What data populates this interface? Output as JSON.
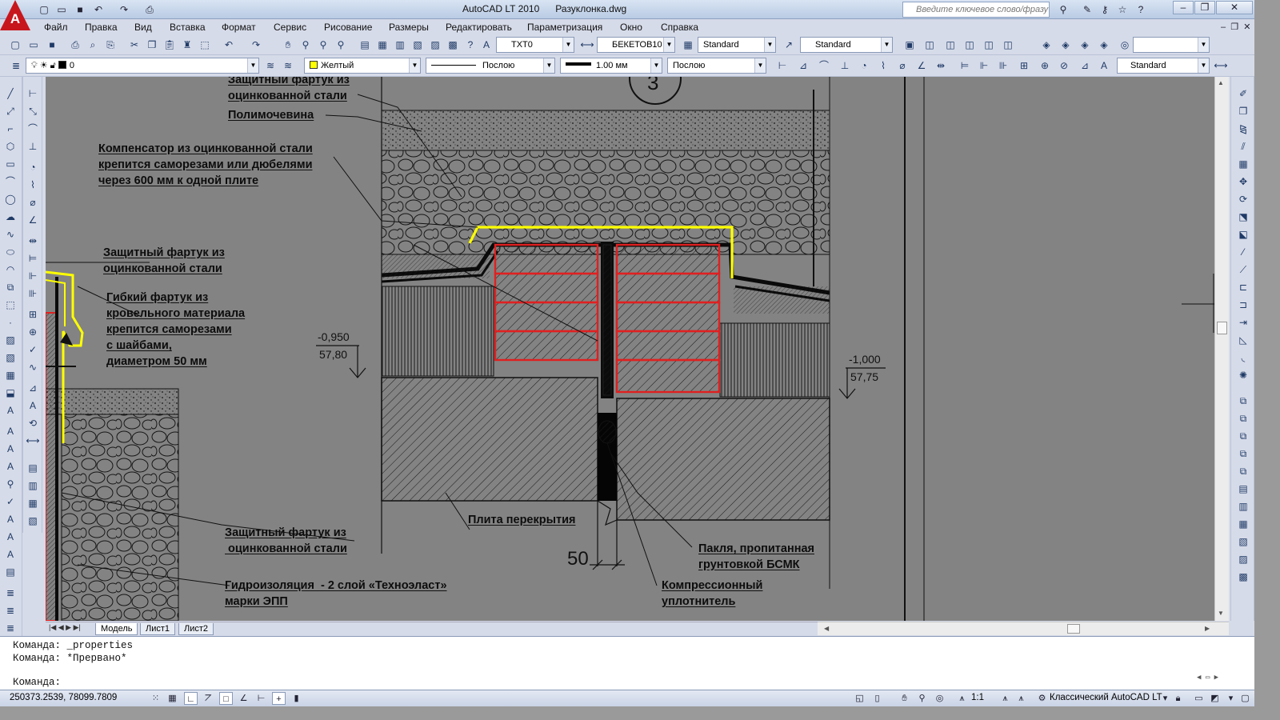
{
  "title_bar": {
    "app_title": "AutoCAD LT 2010",
    "file_name": "Разуклонка.dwg",
    "search_placeholder": "Введите ключевое слово/фразу",
    "logo_letter": "A"
  },
  "menu": [
    "Файл",
    "Правка",
    "Вид",
    "Вставка",
    "Формат",
    "Сервис",
    "Рисование",
    "Размеры",
    "Редактировать",
    "Параметризация",
    "Окно",
    "Справка"
  ],
  "toolbar_standard": {
    "text_style": "TXT0",
    "dim_style": "БЕКЕТОВ10",
    "table_style": "Standard",
    "multileader_style": "Standard",
    "empty_combo": ""
  },
  "toolbar_layers": {
    "layer": "0",
    "color": "Желтый",
    "color_hex": "#ffff00",
    "linetype": "Послою",
    "lineweight": "1.00 мм",
    "plot_style": "Послою",
    "dim_style_2": "Standard"
  },
  "drawing": {
    "annotations": [
      "Защитный фартук из\nоцинкованной стали",
      "Полимочевина",
      "Компенсатор из оцинкованной стали\nкрепится саморезами или дюбелями\nчерез 600 мм к одной плите",
      "Защитный фартук из\nоцинкованной стали",
      "Гибкий фартук из\nкровельного материала\nкрепится саморезами\nс шайбами,\nдиаметром 50 мм",
      "Защитный фартук из\n оцинкованной стали",
      "Гидроизоляция  - 2 слой «Техноэласт»\nмарки ЭПП",
      "Плита перекрытия",
      "Пакля, пропитанная\nгрунтовкой БСМК",
      "Компрессионный\nуплотнитель"
    ],
    "elevation_left": {
      "level": "-0,950",
      "mark": "57,80"
    },
    "elevation_right": {
      "level": "-1,000",
      "mark": "57,75"
    },
    "gap_dimension": "50",
    "section_mark": "3",
    "colors": {
      "background": "#838383",
      "yellow": "#ffff00",
      "red": "#e02020"
    }
  },
  "layout_tabs": [
    "Модель",
    "Лист1",
    "Лист2"
  ],
  "command_line": {
    "history": [
      "Команда:  _properties",
      "Команда:  *Прервано*"
    ],
    "prompt": "Команда:"
  },
  "status_bar": {
    "coordinates": "250373.2539, 78099.7809",
    "scale": "1:1",
    "workspace": "Классический AutoCAD LT"
  }
}
